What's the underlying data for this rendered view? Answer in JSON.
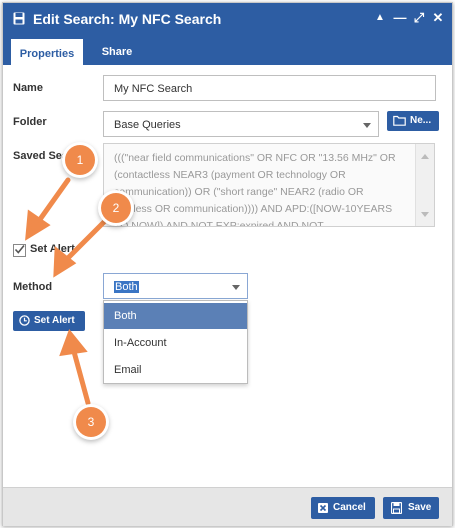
{
  "window": {
    "title": "Edit Search: My NFC Search",
    "buttons": [
      "▲",
      "—",
      "⤢",
      "✕"
    ]
  },
  "tabs": [
    {
      "label": "Properties",
      "active": true
    },
    {
      "label": "Share",
      "active": false
    }
  ],
  "form": {
    "name_label": "Name",
    "name_value": "My NFC Search",
    "folder_label": "Folder",
    "folder_value": "Base Queries",
    "new_button_label": "Ne...",
    "saved_label": "Saved Sea",
    "saved_text": "(((\"near field communications\" OR NFC OR \"13.56 MHz\" OR (contactless NEAR3 (payment OR technology OR communication)) OR (\"short range\" NEAR2 (radio OR wireless OR communication)))) AND APD:([NOW-10YEARS TO NOW]) AND NOT EXP:expired AND NOT",
    "set_alert_checkbox_label": "Set Alert",
    "set_alert_checked": true,
    "method_label": "Method",
    "method_value": "Both",
    "method_options": [
      "Both",
      "In-Account",
      "Email"
    ],
    "set_alert_button_label": "Set Alert"
  },
  "footer": {
    "cancel_label": "Cancel",
    "save_label": "Save"
  },
  "callouts": [
    "1",
    "2",
    "3"
  ],
  "colors": {
    "accent": "#2d5da3",
    "callout": "#f08a4b",
    "selected_option": "#5b80b6"
  }
}
